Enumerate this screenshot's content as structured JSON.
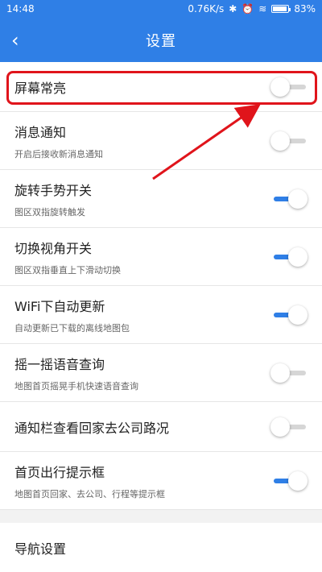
{
  "status_bar": {
    "time": "14:48",
    "network_speed": "0.76K/s",
    "battery": "83%"
  },
  "header": {
    "back_label": "‹",
    "title": "设置"
  },
  "settings": [
    {
      "title": "屏幕常亮",
      "subtitle": "",
      "state": "off"
    },
    {
      "title": "消息通知",
      "subtitle": "开启后接收新消息通知",
      "state": "off"
    },
    {
      "title": "旋转手势开关",
      "subtitle": "图区双指旋转触发",
      "state": "on"
    },
    {
      "title": "切换视角开关",
      "subtitle": "图区双指垂直上下滑动切换",
      "state": "on"
    },
    {
      "title": "WiFi下自动更新",
      "subtitle": "自动更新已下载的离线地图包",
      "state": "on"
    },
    {
      "title": "摇一摇语音查询",
      "subtitle": "地图首页摇晃手机快速语音查询",
      "state": "off"
    },
    {
      "title": "通知栏查看回家去公司路况",
      "subtitle": "",
      "state": "off"
    },
    {
      "title": "首页出行提示框",
      "subtitle": "地图首页回家、去公司、行程等提示框",
      "state": "on"
    }
  ],
  "nav_settings": {
    "label": "导航设置"
  },
  "colors": {
    "accent": "#2f7fe6",
    "annotation": "#e0141b"
  }
}
